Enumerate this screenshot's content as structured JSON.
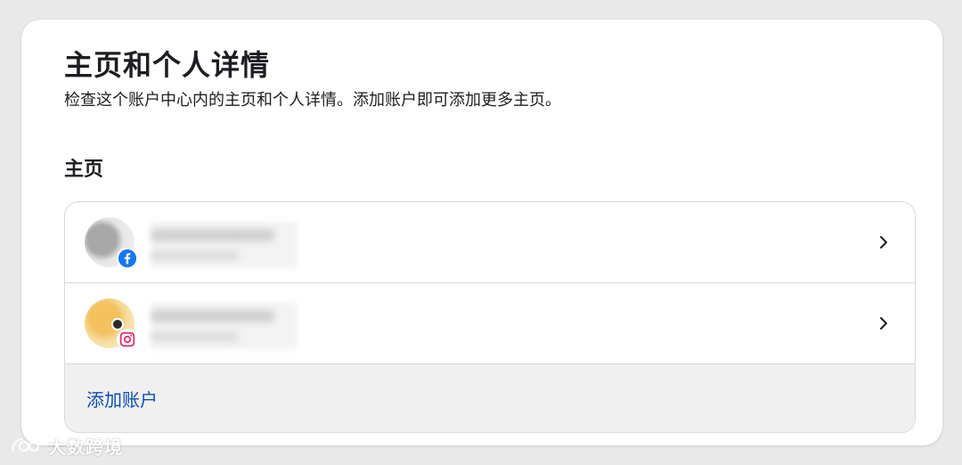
{
  "header": {
    "title": "主页和个人详情",
    "subtitle": "检查这个账户中心内的主页和个人详情。添加账户即可添加更多主页。"
  },
  "section": {
    "title": "主页"
  },
  "accounts": [
    {
      "platform": "facebook",
      "badge_icon": "facebook-icon",
      "badge_color": "#1877f2"
    },
    {
      "platform": "instagram",
      "badge_icon": "instagram-icon",
      "badge_color": "#e1306c"
    }
  ],
  "actions": {
    "add_account_label": "添加账户"
  },
  "watermark": {
    "text": "大数跨境"
  },
  "colors": {
    "link": "#0a4fad",
    "border": "#d7d9dd",
    "card_bg": "#ffffff",
    "footer_bg": "#f0f0f0"
  }
}
